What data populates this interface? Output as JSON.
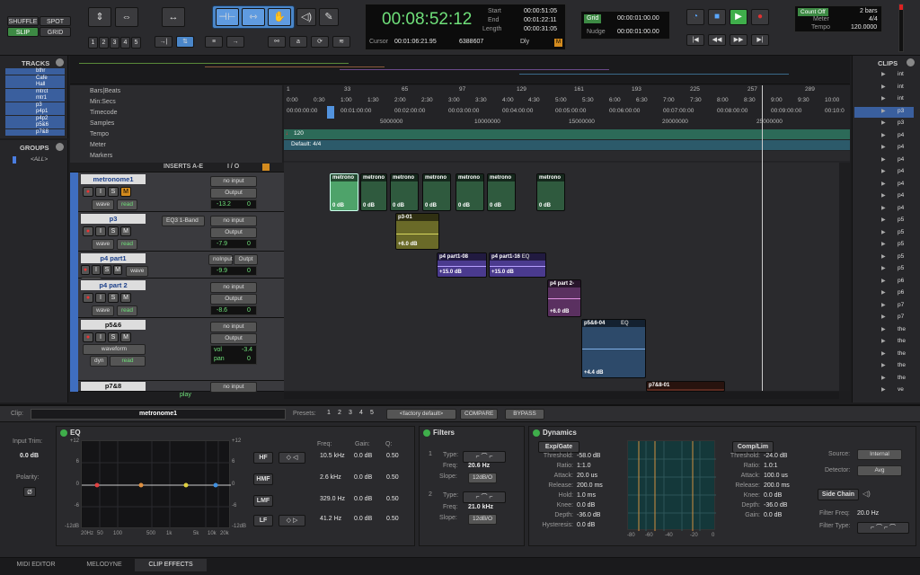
{
  "edit_modes": {
    "shuffle": "SHUFFLE",
    "spot": "SPOT",
    "slip": "SLIP",
    "grid": "GRID"
  },
  "zoom_presets": [
    "1",
    "2",
    "3",
    "4",
    "5"
  ],
  "counter": {
    "main": "00:08:52:12",
    "start_label": "Start",
    "end_label": "End",
    "length_label": "Length",
    "start": "00:00:51:05",
    "end": "00:01:22:11",
    "length": "00:00:31:05",
    "cursor_label": "Cursor",
    "cursor": "00:01:06:21.95",
    "samples": "6388607",
    "dly": "Dly"
  },
  "grid": {
    "grid_label": "Grid",
    "grid_value": "00:00:01:00.00",
    "nudge_label": "Nudge",
    "nudge_value": "00:00:01:00.00"
  },
  "meter": {
    "count_off": "Count Off",
    "bars": "2 bars",
    "meter_label": "Meter",
    "meter_value": "4/4",
    "tempo_label": "Tempo",
    "tempo_value": "120.0000"
  },
  "tracks_panel": {
    "title": "TRACKS",
    "items": [
      "bthr",
      "Cafe",
      "Hall",
      "mtrct",
      "mtr1",
      "p3",
      "p4p1",
      "p4p2",
      "p5&6",
      "p7&8"
    ]
  },
  "groups_panel": {
    "title": "GROUPS",
    "all": "<ALL>"
  },
  "clips_panel": {
    "title": "CLIPS",
    "items": [
      "int",
      "int",
      "int",
      "p3",
      "p3",
      "p4",
      "p4",
      "p4",
      "p4",
      "p4",
      "p4",
      "p4",
      "p5",
      "p5",
      "p5",
      "p5",
      "p5",
      "p6",
      "p6",
      "p7",
      "p7",
      "the",
      "the",
      "the",
      "the",
      "the",
      "ve"
    ]
  },
  "rulers": {
    "bars_beats": "Bars|Beats",
    "min_secs": "Min:Secs",
    "timecode": "Timecode",
    "samples": "Samples",
    "tempo": "Tempo",
    "meter": "Meter",
    "markers": "Markers",
    "bars_ticks": [
      "1",
      "33",
      "65",
      "97",
      "129",
      "161",
      "193",
      "225",
      "257",
      "289"
    ],
    "minsec_ticks": [
      "0:00",
      "0:30",
      "1:00",
      "1:30",
      "2:00",
      "2:30",
      "3:00",
      "3:30",
      "4:00",
      "4:30",
      "5:00",
      "5:30",
      "6:00",
      "6:30",
      "7:00",
      "7:30",
      "8:00",
      "8:30",
      "9:00",
      "9:30",
      "10:00"
    ],
    "tc_ticks": [
      "00:00:00:00",
      "00:01:00:00",
      "00:02:00:00",
      "00:03:00:00",
      "00:04:00:00",
      "00:05:00:00",
      "00:06:00:00",
      "00:07:00:00",
      "00:08:00:00",
      "00:09:00:00",
      "00:10:0"
    ],
    "sample_ticks": [
      "5000000",
      "10000000",
      "15000000",
      "20000000",
      "25000000"
    ],
    "tempo_value": "120",
    "meter_value": "Default: 4/4"
  },
  "mix_header": {
    "inserts": "INSERTS A-E",
    "io": "I / O"
  },
  "tracks": [
    {
      "name": "metronome1",
      "view": "wave",
      "mode": "read",
      "input": "no input",
      "output": "Output",
      "vol": "-13.2",
      "pan": "0"
    },
    {
      "name": "p3",
      "view": "wave",
      "mode": "read",
      "insert": "EQ3 1-Band",
      "input": "no input",
      "output": "Output",
      "vol": "-7.9",
      "pan": "0"
    },
    {
      "name": "p4 part1",
      "view": "wave",
      "mode": "read",
      "input": "noInput",
      "output": "Outpt",
      "vol": "-9.9",
      "pan": "0"
    },
    {
      "name": "p4 part 2",
      "view": "wave",
      "mode": "read",
      "input": "no input",
      "output": "Output",
      "vol": "-8.6",
      "pan": "0"
    },
    {
      "name": "p5&6",
      "view": "waveform",
      "dyn": "dyn",
      "mode": "read",
      "input": "no input",
      "output": "Output",
      "vol_label": "vol",
      "vol": "-3.4",
      "pan_label": "pan",
      "pan": "0"
    },
    {
      "name": "p7&8",
      "input": "no input"
    }
  ],
  "play_label": "play",
  "clips": [
    {
      "name": "metrono",
      "gain": "0 dB"
    },
    {
      "name": "metrono",
      "gain": "0 dB"
    },
    {
      "name": "metrono",
      "gain": "0 dB"
    },
    {
      "name": "metrono",
      "gain": "0 dB"
    },
    {
      "name": "metrono",
      "gain": "0 dB"
    },
    {
      "name": "metrono",
      "gain": "0 dB"
    },
    {
      "name": "metrono",
      "gain": "0 dB"
    },
    {
      "name": "p3-01",
      "gain": "+6.0 dB"
    },
    {
      "name": "p4 part1-08",
      "gain": "+15.0 dB"
    },
    {
      "name": "p4 part1-16",
      "tag": "EQ",
      "gain": "+15.0 dB"
    },
    {
      "name": "p4 part 2-",
      "gain": "+6.0 dB"
    },
    {
      "name": "p5&6-04",
      "tag": "EQ",
      "gain": "+4.4 dB"
    },
    {
      "name": "p7&8-01"
    }
  ],
  "clip_bar": {
    "clip_label": "Clip:",
    "clip_name": "metronome1",
    "presets_label": "Presets:",
    "preset_nums": [
      "1",
      "2",
      "3",
      "4",
      "5"
    ],
    "factory": "<factory default>",
    "compare": "COMPARE",
    "bypass": "BYPASS"
  },
  "eq": {
    "title": "EQ",
    "input_trim_label": "Input Trim:",
    "input_trim": "0.0 dB",
    "polarity_label": "Polarity:",
    "phase": "Ø",
    "y_ticks": [
      "+12",
      "6",
      "0",
      "-6",
      "-12dB"
    ],
    "y_ticks_right": [
      "+12",
      "6",
      "0",
      "-6",
      "-12dB"
    ],
    "x_ticks": [
      "20Hz",
      "50",
      "100",
      "500",
      "1k",
      "5k",
      "10k",
      "20k"
    ],
    "col_freq": "Freq:",
    "col_gain": "Gain:",
    "col_q": "Q:",
    "bands": [
      {
        "name": "HF",
        "freq": "10.5 kHz",
        "gain": "0.0 dB",
        "q": "0.50"
      },
      {
        "name": "HMF",
        "freq": "2.6 kHz",
        "gain": "0.0 dB",
        "q": "0.50"
      },
      {
        "name": "LMF",
        "freq": "329.0 Hz",
        "gain": "0.0 dB",
        "q": "0.50"
      },
      {
        "name": "LF",
        "freq": "41.2 Hz",
        "gain": "0.0 dB",
        "q": "0.50"
      }
    ]
  },
  "filters": {
    "title": "Filters",
    "f1": {
      "num": "1",
      "type_label": "Type:",
      "freq_label": "Freq:",
      "freq": "20.6 Hz",
      "slope_label": "Slope:",
      "slope": "12dB/O"
    },
    "f2": {
      "num": "2",
      "type_label": "Type:",
      "freq_label": "Freq:",
      "freq": "21.0 kHz",
      "slope_label": "Slope:",
      "slope": "12dB/O"
    }
  },
  "dynamics": {
    "title": "Dynamics",
    "expgate": "Exp/Gate",
    "compl": "Comp/Lim",
    "gate": [
      [
        "Threshold:",
        "-58.0 dB"
      ],
      [
        "Ratio:",
        "1:1.0"
      ],
      [
        "Attack:",
        "20.0 us"
      ],
      [
        "Release:",
        "200.0 ms"
      ],
      [
        "Hold:",
        "1.0 ms"
      ],
      [
        "Knee:",
        "0.0 dB"
      ],
      [
        "Depth:",
        "-36.0 dB"
      ],
      [
        "Hysteresis:",
        "0.0 dB"
      ]
    ],
    "comp": [
      [
        "Threshold:",
        "-24.0 dB"
      ],
      [
        "Ratio:",
        "1.0:1"
      ],
      [
        "Attack:",
        "100.0 us"
      ],
      [
        "Release:",
        "200.0 ms"
      ],
      [
        "Knee:",
        "0.0 dB"
      ],
      [
        "Depth:",
        "-36.0 dB"
      ],
      [
        "Gain:",
        "0.0 dB"
      ]
    ],
    "graph_x": [
      "-80",
      "-60",
      "-40",
      "-20",
      "0"
    ],
    "source_label": "Source:",
    "source": "Internal",
    "detector_label": "Detector:",
    "detector": "Avg",
    "sidechain": "Side Chain",
    "sc_freq_label": "Filter Freq:",
    "sc_freq": "20.0 Hz",
    "sc_type_label": "Filter Type:"
  },
  "bottom_tabs": [
    "MIDI EDITOR",
    "MELODYNE",
    "CLIP EFFECTS"
  ]
}
